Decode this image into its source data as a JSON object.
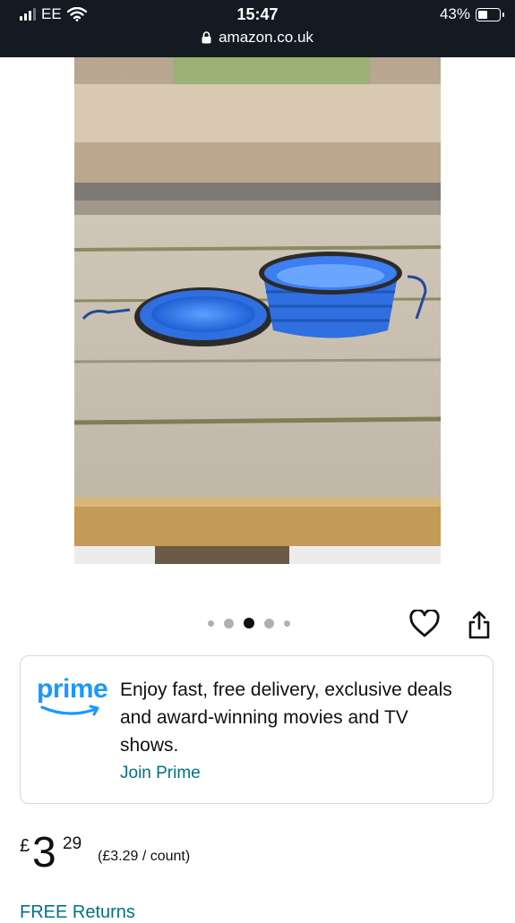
{
  "status_bar": {
    "carrier": "EE",
    "time": "15:47",
    "battery": "43%",
    "battery_level": 0.43,
    "url": "amazon.co.uk"
  },
  "gallery": {
    "image_count": 5,
    "active_index": 2
  },
  "prime": {
    "logo_text": "prime",
    "message": "Enjoy fast, free delivery, exclusive deals and award-winning movies and TV shows.",
    "join_label": "Join Prime"
  },
  "price": {
    "symbol": "£",
    "whole": "3",
    "fraction": "29",
    "unit": "(£3.29 / count)"
  },
  "returns": {
    "label": "FREE Returns"
  },
  "colors": {
    "status_bar_bg": "#131a22",
    "prime_blue": "#1a98ff",
    "link_teal": "#007185",
    "bowl_blue": "#2f6fe0"
  }
}
